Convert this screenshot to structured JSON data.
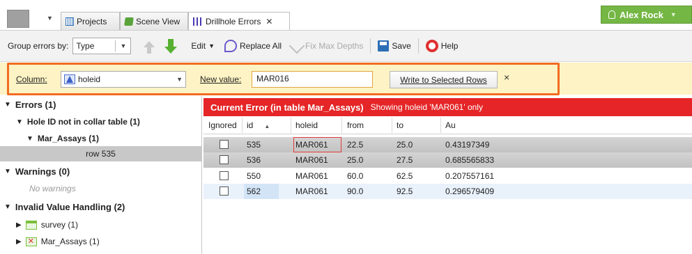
{
  "tabs": {
    "projects": "Projects",
    "scene_view": "Scene View",
    "drillhole_errors": "Drillhole Errors"
  },
  "user": {
    "name": "Alex Rock"
  },
  "toolbar": {
    "group_by_label": "Group errors by:",
    "group_by_value": "Type",
    "edit_label": "Edit",
    "replace_all_label": "Replace All",
    "fix_max_depths_label": "Fix Max Depths",
    "save_label": "Save",
    "help_label": "Help"
  },
  "replace_bar": {
    "column_label": "Column:",
    "column_value": "holeid",
    "new_value_label": "New value:",
    "new_value": "MAR016",
    "write_button": "Write to Selected Rows",
    "close_glyph": "×"
  },
  "left_panel": {
    "errors": "Errors (1)",
    "hole_id_error": "Hole ID not in collar table (1)",
    "mar_assays": "Mar_Assays (1)",
    "selected_row": "row 535",
    "warnings": "Warnings (0)",
    "no_warnings": "No warnings",
    "invalid_value_handling": "Invalid Value Handling (2)",
    "survey": "survey (1)",
    "mar_assays_invalid": "Mar_Assays (1)"
  },
  "error_header": {
    "title": "Current Error (in table Mar_Assays)",
    "subtitle": "Showing holeid 'MAR061' only"
  },
  "table": {
    "columns": [
      "Ignored",
      "id",
      "holeid",
      "from",
      "to",
      "Au"
    ],
    "rows": [
      {
        "id": "535",
        "holeid": "MAR061",
        "from": "22.5",
        "to": "25.0",
        "au": "0.43197349"
      },
      {
        "id": "536",
        "holeid": "MAR061",
        "from": "25.0",
        "to": "27.5",
        "au": "0.685565833"
      },
      {
        "id": "550",
        "holeid": "MAR061",
        "from": "60.0",
        "to": "62.5",
        "au": "0.207557161"
      },
      {
        "id": "562",
        "holeid": "MAR061",
        "from": "90.0",
        "to": "92.5",
        "au": "0.296579409"
      }
    ]
  },
  "colors": {
    "accent_orange": "#f26b21",
    "error_red": "#e52527",
    "user_green": "#74b744",
    "replace_bar_bg": "#fdf3c4"
  }
}
